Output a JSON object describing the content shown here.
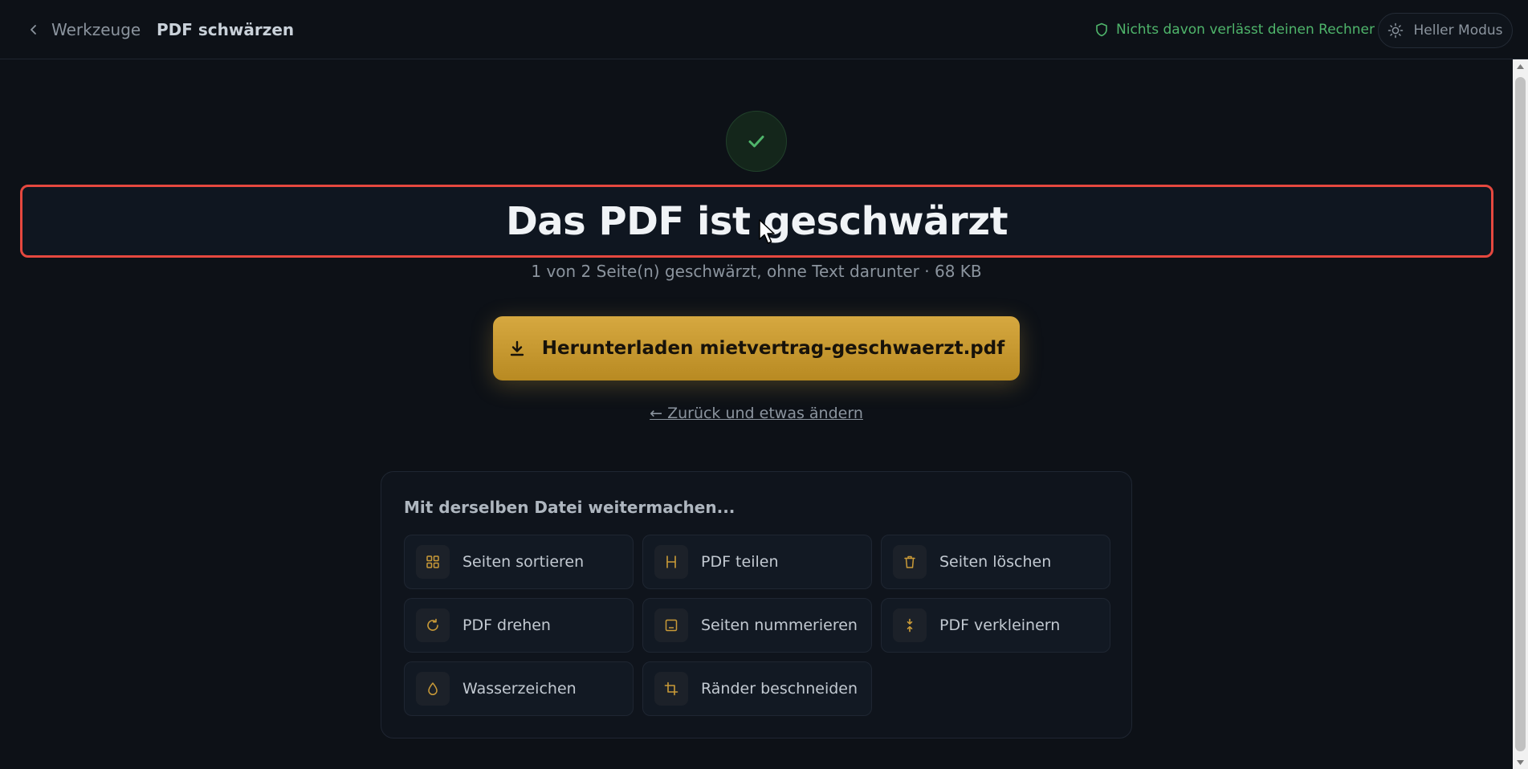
{
  "header": {
    "back_label": "Werkzeuge",
    "tool_title": "PDF schwärzen",
    "privacy_text": "Nichts davon verlässt deinen Rechner",
    "theme_label": "Heller Modus"
  },
  "result": {
    "headline": "Das PDF ist geschwärzt",
    "subline": "1 von 2 Seite(n) geschwärzt, ohne Text darunter · 68 KB",
    "download_label": "Herunterladen mietvertrag-geschwaerzt.pdf",
    "back_link": "← Zurück und etwas ändern"
  },
  "continue": {
    "title": "Mit derselben Datei weitermachen...",
    "tools": [
      {
        "label": "Seiten sortieren",
        "icon": "grid-icon"
      },
      {
        "label": "PDF teilen",
        "icon": "split-icon"
      },
      {
        "label": "Seiten löschen",
        "icon": "trash-icon"
      },
      {
        "label": "PDF drehen",
        "icon": "rotate-icon"
      },
      {
        "label": "Seiten nummerieren",
        "icon": "page-number-icon"
      },
      {
        "label": "PDF verkleinern",
        "icon": "compress-icon"
      },
      {
        "label": "Wasserzeichen",
        "icon": "droplet-icon"
      },
      {
        "label": "Ränder beschneiden",
        "icon": "crop-icon"
      }
    ]
  },
  "colors": {
    "background": "#0d1117",
    "accent": "#d6a840",
    "success": "#4fb56b",
    "highlight": "#e5483f"
  }
}
